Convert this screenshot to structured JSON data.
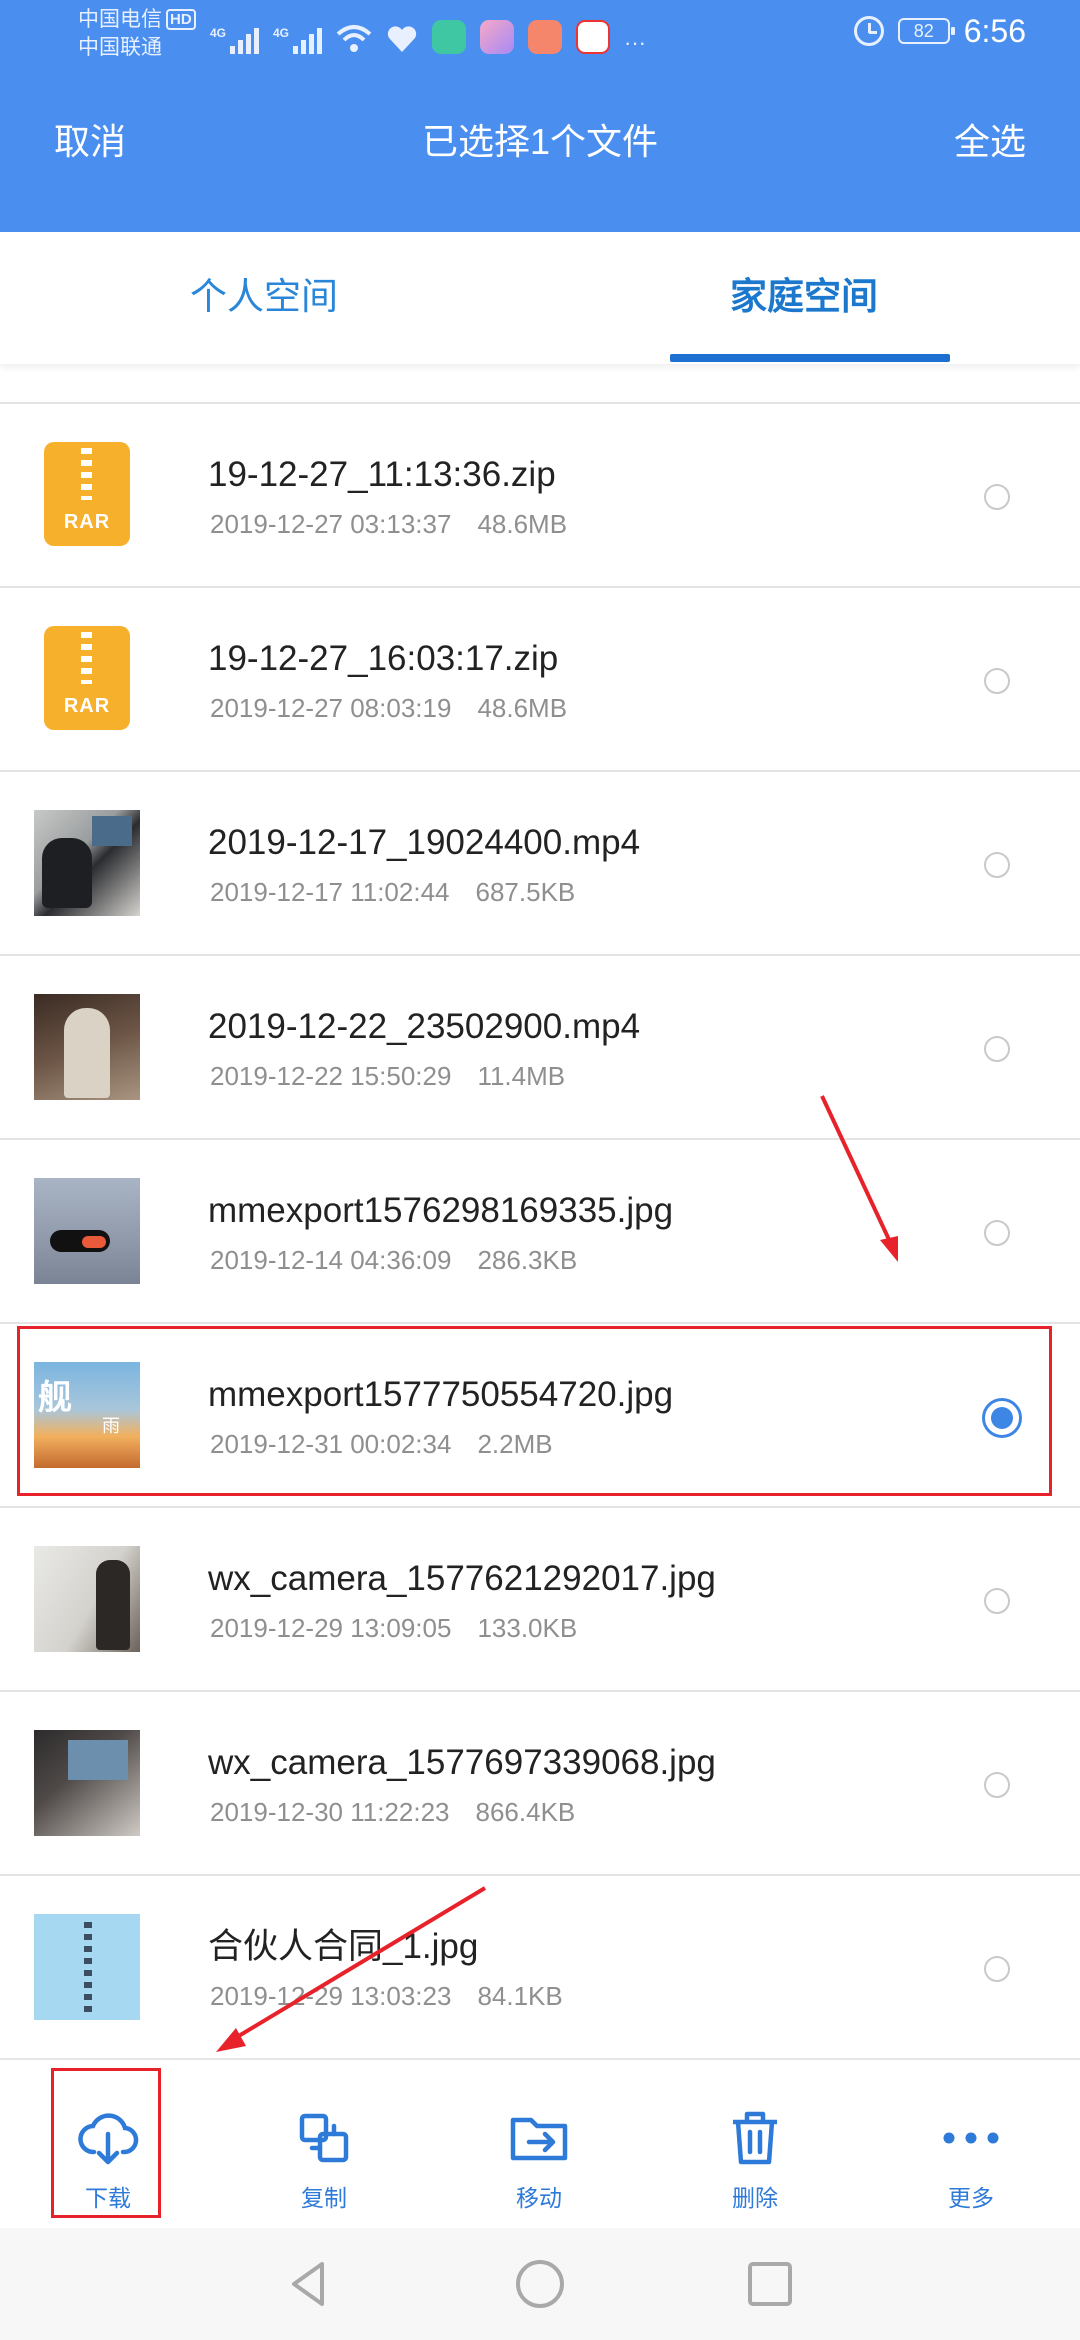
{
  "status_bar": {
    "carrier_1": "中国电信",
    "carrier_1_badge": "HD",
    "carrier_2": "中国联通",
    "network_1": "4G",
    "network_2": "4G",
    "more_indicator": "···",
    "battery": "82",
    "time": "6:56"
  },
  "nav": {
    "cancel_label": "取消",
    "title": "已选择1个文件",
    "select_all_label": "全选"
  },
  "tabs": [
    {
      "label": "个人空间",
      "active": false
    },
    {
      "label": "家庭空间",
      "active": true
    }
  ],
  "files": [
    {
      "name": "19-12-27_11:13:36.zip",
      "date": "2019-12-27 03:13:37",
      "size": "48.6MB",
      "type": "rar",
      "selected": false
    },
    {
      "name": "19-12-27_16:03:17.zip",
      "date": "2019-12-27 08:03:19",
      "size": "48.6MB",
      "type": "rar",
      "selected": false
    },
    {
      "name": "2019-12-17_19024400.mp4",
      "date": "2019-12-17 11:02:44",
      "size": "687.5KB",
      "type": "video",
      "selected": false
    },
    {
      "name": "2019-12-22_23502900.mp4",
      "date": "2019-12-22 15:50:29",
      "size": "11.4MB",
      "type": "video",
      "selected": false
    },
    {
      "name": "mmexport1576298169335.jpg",
      "date": "2019-12-14 04:36:09",
      "size": "286.3KB",
      "type": "image",
      "selected": false
    },
    {
      "name": "mmexport1577750554720.jpg",
      "date": "2019-12-31 00:02:34",
      "size": "2.2MB",
      "type": "image",
      "selected": true
    },
    {
      "name": "wx_camera_1577621292017.jpg",
      "date": "2019-12-29 13:09:05",
      "size": "133.0KB",
      "type": "image",
      "selected": false
    },
    {
      "name": "wx_camera_1577697339068.jpg",
      "date": "2019-12-30 11:22:23",
      "size": "866.4KB",
      "type": "image",
      "selected": false
    },
    {
      "name": "合伙人合同_1.jpg",
      "date": "2019-12-29 13:03:23",
      "size": "84.1KB",
      "type": "image",
      "selected": false
    }
  ],
  "rar_icon_label": "RAR",
  "thumb_text": {
    "glyph": "舰",
    "small": "雨"
  },
  "toolbar": {
    "download": "下载",
    "copy": "复制",
    "move": "移动",
    "delete": "删除",
    "more": "更多"
  },
  "colors": {
    "header_blue": "#4a8ff0",
    "accent_blue": "#2d7ad8",
    "annotation_red": "#e8222b"
  },
  "icons": [
    "download-cloud-icon",
    "copy-icon",
    "move-folder-icon",
    "trash-icon",
    "more-dots-icon",
    "back-icon",
    "home-icon",
    "recent-apps-icon"
  ]
}
